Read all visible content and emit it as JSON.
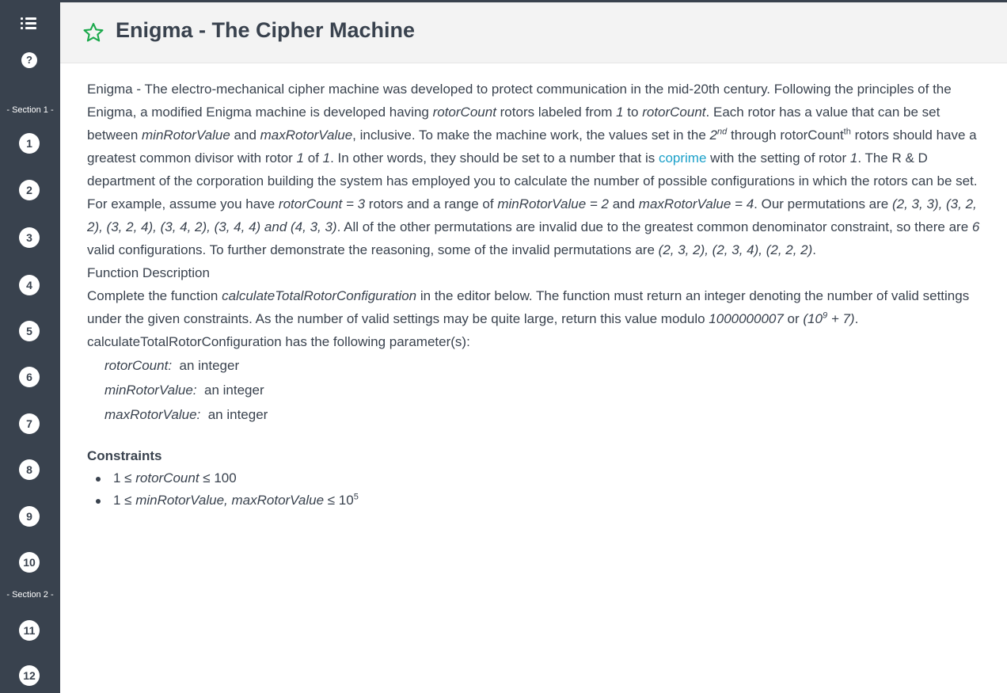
{
  "sidebar": {
    "section1_label": "- Section 1 -",
    "section2_label": "- Section 2 -",
    "help_label": "?",
    "questions": [
      "1",
      "2",
      "3",
      "4",
      "5",
      "6",
      "7",
      "8",
      "9",
      "10",
      "11",
      "12"
    ]
  },
  "header": {
    "title": "Enigma - The Cipher Machine"
  },
  "problem": {
    "p1": {
      "a": "Enigma - The electro-mechanical cipher machine was developed to protect communication in the mid-20th century. Following the principles of the Enigma, a modified Enigma machine is developed having ",
      "b": "rotorCount",
      "c": " rotors labeled from ",
      "d": "1",
      "e": " to ",
      "f": "rotorCount",
      "g": ". Each rotor has a value that can be set between ",
      "h": "minRotorValue",
      "i": " and ",
      "j": "maxRotorValue",
      "k": ", inclusive. To make the machine work, the values set in the ",
      "l": "2",
      "l_sup": "nd",
      "m": " through rotorCount",
      "m_sup": "th",
      "n": " rotors should have a greatest common divisor with rotor ",
      "o": "1",
      "p": " of ",
      "q": "1",
      "r": ". In other words, they should be set to a number that is ",
      "link": "coprime",
      "s": " with the setting of rotor ",
      "t": "1",
      "u": ". The R & D department of the corporation building the system has employed you to calculate the number of possible configurations in which the rotors can be set."
    },
    "p2": {
      "a": "For example, assume you have ",
      "b": "rotorCount = 3",
      "c": " rotors and a range of ",
      "d": "minRotorValue = 2",
      "e": " and ",
      "f": "maxRotorValue = 4",
      "g": ". Our permutations are ",
      "h": "(2, 3, 3), (3, 2, 2), (3, 2, 4), (3, 4, 2), (3, 4, 4) and (4, 3, 3)",
      "i": ". All of the other permutations are invalid due to the greatest common denominator constraint, so there are ",
      "j": "6",
      "k": " valid configurations. To further demonstrate the reasoning, some of the invalid permutations are ",
      "l": "(2, 3, 2), (2, 3, 4), (2, 2, 2)",
      "m": "."
    },
    "func_desc": {
      "heading": "Function Description",
      "a": "Complete the function ",
      "b": "calculateTotalRotorConfiguration",
      "c": " in the editor below. The function must return an integer denoting the number of valid settings under the given constraints. As the number of valid settings may be quite large, return this value modulo ",
      "d": "1000000007",
      "e": " or ",
      "f": "(10",
      "f_sup": "9",
      "g": " + 7)",
      "h": "."
    },
    "params": {
      "intro": "calculateTotalRotorConfiguration has the following parameter(s):",
      "items": [
        {
          "name": "rotorCount:",
          "desc": "  an integer"
        },
        {
          "name": "minRotorValue:",
          "desc": "  an integer"
        },
        {
          "name": "maxRotorValue:",
          "desc": "  an integer"
        }
      ]
    },
    "constraints": {
      "heading": "Constraints",
      "c1": {
        "a": "1 ≤ ",
        "b": "rotorCount",
        "c": " ≤ 100"
      },
      "c2": {
        "a": "1 ≤ ",
        "b": "minRotorValue, maxRotorValue",
        "c": " ≤ 10",
        "sup": "5"
      }
    }
  },
  "colors": {
    "sidebar_bg": "#39424e",
    "link": "#1ba0c9",
    "star": "#1ba94c"
  }
}
